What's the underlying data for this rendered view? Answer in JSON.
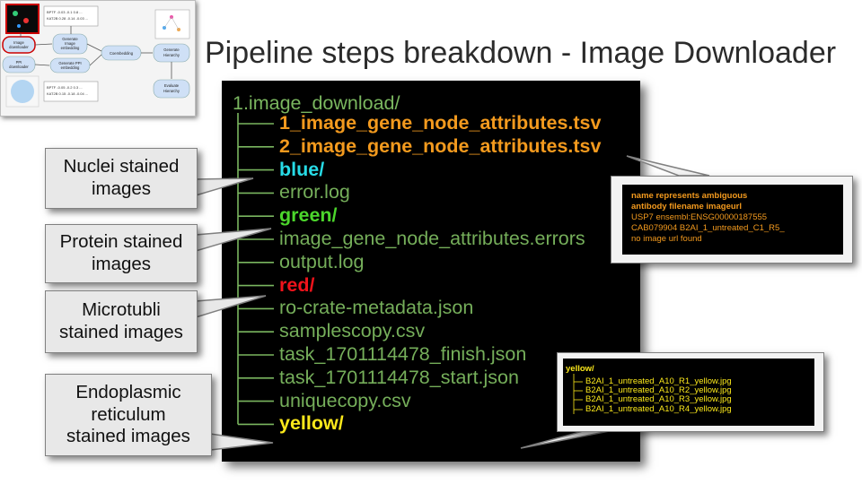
{
  "title": "Pipeline steps breakdown - Image Downloader",
  "thumbnail": {
    "nodes": [
      {
        "label": "Image\ndownloader",
        "highlighted": true
      },
      {
        "label": "Generate\nImage\nembedding"
      },
      {
        "label": "PPI\ndownloader"
      },
      {
        "label": "Generate PPI\nembedding"
      },
      {
        "label": "Coembedding"
      },
      {
        "label": "Generate\nHierarchy"
      },
      {
        "label": "Evaluate\nHierarchy"
      }
    ],
    "table_top": [
      "BPTF  -0.03  -0.1  0.8 ...",
      "KAT2B  0.28  -0.14  -0.03 ..."
    ],
    "table_bottom": [
      "BPTF  -0.05  -0.2  0.3 ...",
      "KAT2B  0.15  -0.18  -0.04 ..."
    ]
  },
  "tree": {
    "root": "1.image_download/",
    "entries": [
      {
        "name": "1_image_gene_node_attributes.tsv",
        "style": "orange"
      },
      {
        "name": "2_image_gene_node_attributes.tsv",
        "style": "orange"
      },
      {
        "name": "blue/",
        "style": "cyan"
      },
      {
        "name": "error.log",
        "style": "file"
      },
      {
        "name": "green/",
        "style": "green"
      },
      {
        "name": "image_gene_node_attributes.errors",
        "style": "file"
      },
      {
        "name": "output.log",
        "style": "file"
      },
      {
        "name": "red/",
        "style": "red"
      },
      {
        "name": "ro-crate-metadata.json",
        "style": "file"
      },
      {
        "name": "samplescopy.csv",
        "style": "file"
      },
      {
        "name": "task_1701114478_finish.json",
        "style": "file"
      },
      {
        "name": "task_1701114478_start.json",
        "style": "file"
      },
      {
        "name": "uniquecopy.csv",
        "style": "file"
      },
      {
        "name": "yellow/",
        "style": "yellow"
      }
    ]
  },
  "callouts": [
    {
      "lines": [
        "Nuclei stained",
        "images"
      ]
    },
    {
      "lines": [
        "Protein stained",
        "images"
      ]
    },
    {
      "lines": [
        "Microtubli",
        "stained images"
      ]
    },
    {
      "lines": [
        "Endoplasmic",
        "reticulum",
        "stained images"
      ]
    }
  ],
  "error_inset": {
    "header1": "name     represents       ambiguous",
    "header2": "antibody         filename          imageurl",
    "row1": "USP7     ensembl:ENSG00000187555",
    "row2": "CAB079904        B2AI_1_untreated_C1_R5_",
    "row3": "no image url found"
  },
  "yellow_inset": {
    "folder": "yellow/",
    "files": [
      "B2AI_1_untreated_A10_R1_yellow.jpg",
      "B2AI_1_untreated_A10_R2_yellow.jpg",
      "B2AI_1_untreated_A10_R3_yellow.jpg",
      "B2AI_1_untreated_A10_R4_yellow.jpg"
    ]
  },
  "colors": {
    "orange": "#f39a1e",
    "cyan": "#27dbe6",
    "green": "#4cd62c",
    "red": "#f0131b",
    "yellow": "#fbe81b",
    "file": "#75ae5a"
  }
}
